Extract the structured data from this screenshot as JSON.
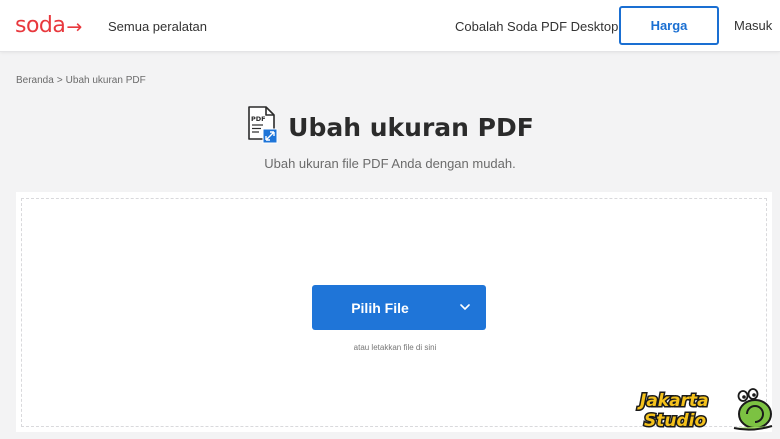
{
  "header": {
    "logo_text": "soda",
    "logo_arrow": "→",
    "all_tools": "Semua peralatan",
    "try_desktop": "Cobalah Soda PDF Desktop",
    "pricing": "Harga",
    "login": "Masuk"
  },
  "breadcrumb": {
    "home": "Beranda",
    "separator": ">",
    "current": "Ubah ukuran PDF"
  },
  "main": {
    "title": "Ubah ukuran PDF",
    "subtitle": "Ubah ukuran file PDF Anda dengan mudah.",
    "icon": "pdf-resize-icon",
    "icon_label": "PDF"
  },
  "upload": {
    "button_label": "Pilih File",
    "drop_hint": "atau letakkan file di sini"
  },
  "watermark": {
    "line1": "Jakarta",
    "line2": "Studio"
  },
  "colors": {
    "brand": "#e8383d",
    "accent": "#1f75d8",
    "background": "#f3f3f4"
  }
}
